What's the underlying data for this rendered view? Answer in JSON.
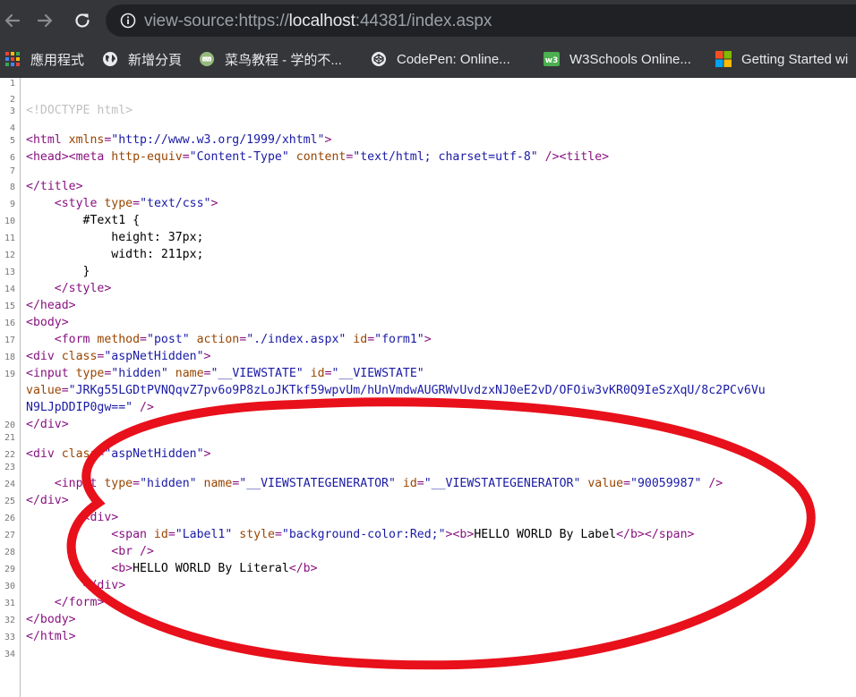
{
  "browser": {
    "url_prefix": "view-source:https://",
    "url_host": "localhost",
    "url_suffix": ":44381/index.aspx"
  },
  "bookmarks": [
    {
      "label": "應用程式",
      "icon": "apps-grid-icon"
    },
    {
      "label": "新增分頁",
      "icon": "globe-icon"
    },
    {
      "label": "菜鸟教程 - 学的不...",
      "icon": "runoob-icon"
    },
    {
      "label": "CodePen: Online...",
      "icon": "codepen-icon"
    },
    {
      "label": "W3Schools Online...",
      "icon": "w3schools-icon"
    },
    {
      "label": "Getting Started wi",
      "icon": "microsoft-icon"
    }
  ],
  "line_numbers": [
    "1",
    "2",
    "3",
    "4",
    "5",
    "6",
    "7",
    "8",
    "9",
    "10",
    "11",
    "12",
    "13",
    "14",
    "15",
    "16",
    "17",
    "18",
    "19",
    "",
    "20",
    "21",
    "22",
    "23",
    "24",
    "25",
    "26",
    "27",
    "28",
    "29",
    "30",
    "31",
    "32",
    "33",
    "34"
  ],
  "source": {
    "doctype": "<!DOCTYPE html>",
    "l5": {
      "open": "<html ",
      "attr": "xmlns",
      "eq": "=",
      "val": "\"http://www.w3.org/1999/xhtml\"",
      "close": ">"
    },
    "l6": {
      "head": "<head>",
      "meta_open": "<meta ",
      "a1": "http-equiv",
      "v1": "\"Content-Type\"",
      "a2": "content",
      "v2": "\"text/html; charset=utf-8\"",
      "meta_close": " />",
      "title": "<title>"
    },
    "l8": "</title>",
    "l9": {
      "open": "<style ",
      "attr": "type",
      "val": "\"text/css\"",
      "close": ">"
    },
    "l10": "#Text1 {",
    "l11": "height: 37px;",
    "l12": "width: 211px;",
    "l13": "}",
    "l14": "</style>",
    "l15": "</head>",
    "l16": "<body>",
    "l17": {
      "open": "<form ",
      "a1": "method",
      "v1": "\"post\"",
      "a2": "action",
      "v2": "\"./index.aspx\"",
      "a3": "id",
      "v3": "\"form1\"",
      "close": ">"
    },
    "l18": {
      "open": "<div ",
      "attr": "class",
      "val": "\"aspNetHidden\"",
      "close": ">"
    },
    "l19": {
      "open": "<input ",
      "a1": "type",
      "v1": "\"hidden\"",
      "a2": "name",
      "v2": "\"__VIEWSTATE\"",
      "a3": "id",
      "v3": "\"__VIEWSTATE\""
    },
    "l19b": {
      "attr": "value",
      "val": "\"JRKg55LGDtPVNQqvZ7pv6o9P8zLoJKTkf59wpvUm/hUnVmdwAUGRWvUvdzxNJ0eE2vD/OFOiw3vKR0Q9IeSzXqU/8c2PCv6Vu"
    },
    "l19c": {
      "val": "N9LJpDDIP0gw==\"",
      "close": " />"
    },
    "l20": "</div>",
    "l22": {
      "open": "<div ",
      "attr": "class",
      "val": "\"aspNetHidden\"",
      "close": ">"
    },
    "l24": {
      "open": "<input ",
      "a1": "type",
      "v1": "\"hidden\"",
      "a2": "name",
      "v2": "\"__VIEWSTATEGENERATOR\"",
      "a3": "id",
      "v3": "\"__VIEWSTATEGENERATOR\"",
      "a4": "value",
      "v4": "\"90059987\"",
      "close": " />"
    },
    "l25": "</div>",
    "l26": "<div>",
    "l27": {
      "open": "<span ",
      "a1": "id",
      "v1": "\"Label1\"",
      "a2": "style",
      "v2": "\"background-color:Red;\"",
      "close": ">",
      "b_open": "<b>",
      "text": "HELLO WORLD By Label",
      "b_close": "</b>",
      "span_close": "</span>"
    },
    "l28": "<br />",
    "l29": {
      "b_open": "<b>",
      "text": "HELLO WORLD By Literal",
      "b_close": "</b>"
    },
    "l30": "</div>",
    "l31": "</form>",
    "l32": "</body>",
    "l33": "</html>"
  },
  "colors": {
    "tag": "#881280",
    "attr_name": "#994500",
    "attr_value": "#1a1aa6",
    "annotation": "#e8101b"
  }
}
